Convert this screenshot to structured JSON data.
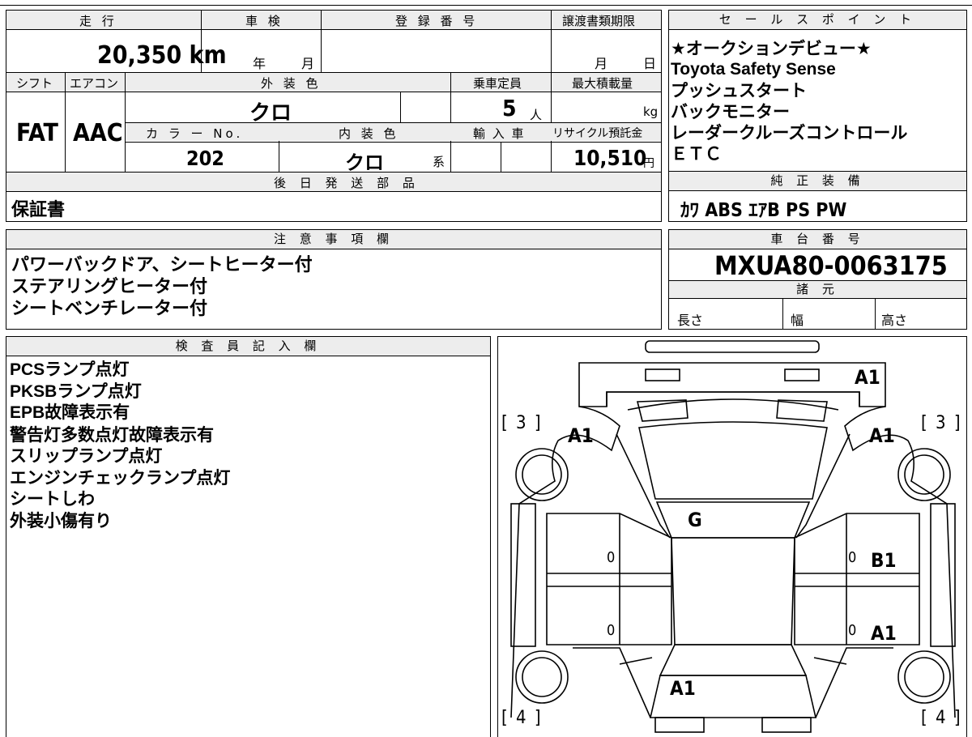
{
  "specs": {
    "mileage_label": "走 行",
    "mileage": "20,350 km",
    "shaken_label": "車 検",
    "shaken_year": "年",
    "shaken_month": "月",
    "reg_label": "登 録 番 号",
    "transfer_label": "譲渡書類期限",
    "transfer_month": "月",
    "transfer_day": "日",
    "shift_label": "シフト",
    "shift": "FAT",
    "ac_label": "エアコン",
    "ac": "AAC",
    "exterior_label": "外 装 色",
    "exterior": "クロ",
    "capacity_label": "乗車定員",
    "capacity": "5",
    "capacity_unit": "人",
    "load_label": "最大積載量",
    "load_unit": "kg",
    "color_no_label": "カ ラ ー No.",
    "color_no": "202",
    "interior_label": "内 装 色",
    "interior": "クロ",
    "interior_suffix": "系",
    "import_label": "輸 入 車",
    "recycle_label": "リサイクル預託金",
    "recycle": "10,510",
    "recycle_unit": "円",
    "later_label": "後 日 発 送 部 品",
    "later_item": "保証書"
  },
  "sales": {
    "label": "セ ー ル ス ポ イ ン ト",
    "points": [
      "★オークションデビュー★",
      "Toyota Safety Sense",
      "プッシュスタート",
      "バックモニター",
      "レーダークルーズコントロール",
      "ＥＴＣ"
    ]
  },
  "equip": {
    "label": "純 正 装 備",
    "value": "ｶﾜ ABS ｴｱB PS PW"
  },
  "notes": {
    "label": "注 意 事 項 欄",
    "lines": [
      "パワーバックドア、シートヒーター付",
      "ステアリングヒーター付",
      "シートベンチレーター付"
    ]
  },
  "chassis": {
    "label": "車 台 番 号",
    "value": "MXUA80-0063175",
    "spec_label": "諸 元",
    "length": "長さ",
    "width": "幅",
    "height": "高さ"
  },
  "inspector": {
    "label": "検 査 員 記 入 欄",
    "lines": [
      "PCSランプ点灯",
      "PKSBランプ点灯",
      "EPB故障表示有",
      "警告灯多数点灯故障表示有",
      "スリップランプ点灯",
      "エンジンチェックランプ点灯",
      "シートしわ",
      "外装小傷有り"
    ]
  },
  "diagram": {
    "marks": {
      "rear_top": "A1",
      "left_front": "A1",
      "right_front": "A1",
      "center": "G",
      "left_door_front": "0",
      "right_door_front": "0",
      "right_door_b1": "B1",
      "left_door_rear": "0",
      "right_door_rear": "0",
      "right_door_a1": "A1",
      "front_bottom": "A1"
    },
    "tags": {
      "tl": "[ 3 ]",
      "tr": "[ 3 ]",
      "bl": "[ 4 ]",
      "br": "[ 4 ]"
    }
  }
}
